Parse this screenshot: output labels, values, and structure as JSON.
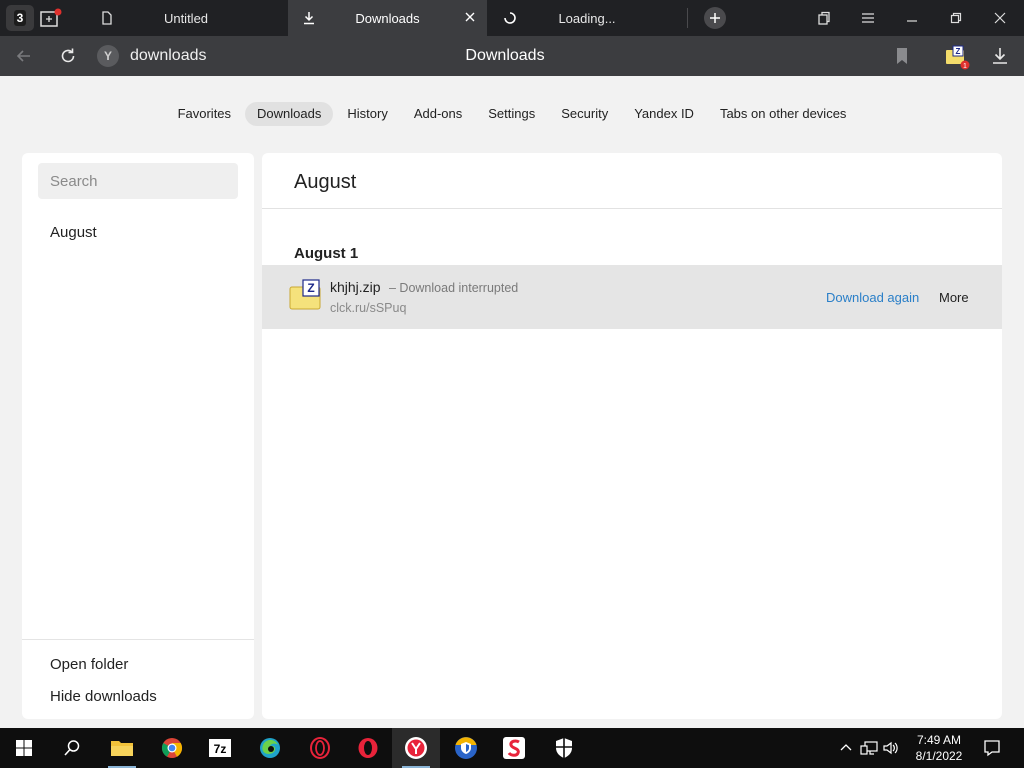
{
  "browser": {
    "tab_count": "3",
    "tabs": [
      {
        "label": "Untitled",
        "icon": "page-icon"
      },
      {
        "label": "Downloads",
        "icon": "download-icon",
        "active": true
      },
      {
        "label": "Loading...",
        "icon": "spinner-icon"
      }
    ],
    "address": "downloads",
    "page_title": "Downloads",
    "extension_badge": "1"
  },
  "nav": {
    "items": [
      "Favorites",
      "Downloads",
      "History",
      "Add-ons",
      "Settings",
      "Security",
      "Yandex ID",
      "Tabs on other devices"
    ],
    "active": "Downloads"
  },
  "sidebar": {
    "search_placeholder": "Search",
    "months": [
      "August"
    ],
    "open_folder": "Open folder",
    "hide_downloads": "Hide downloads"
  },
  "main": {
    "header": "August",
    "groups": [
      {
        "date": "August 1",
        "items": [
          {
            "name": "khjhj.zip",
            "status": "– Download interrupted",
            "url": "clck.ru/sSPuq",
            "action_primary": "Download again",
            "action_more": "More"
          }
        ]
      }
    ]
  },
  "taskbar": {
    "apps": [
      "start-icon",
      "search-icon",
      "file-explorer-icon",
      "chrome-icon",
      "7zip-icon",
      "edge-icon",
      "opera-outline-icon",
      "opera-icon",
      "yandex-browser-icon",
      "shield-browser-icon",
      "s-app-icon",
      "security-shield-icon"
    ],
    "time": "7:49 AM",
    "date": "8/1/2022"
  },
  "colors": {
    "accent_link": "#2a7fc8",
    "tabstrip_bg": "#202124",
    "toolbar_bg": "#3c3d40"
  }
}
